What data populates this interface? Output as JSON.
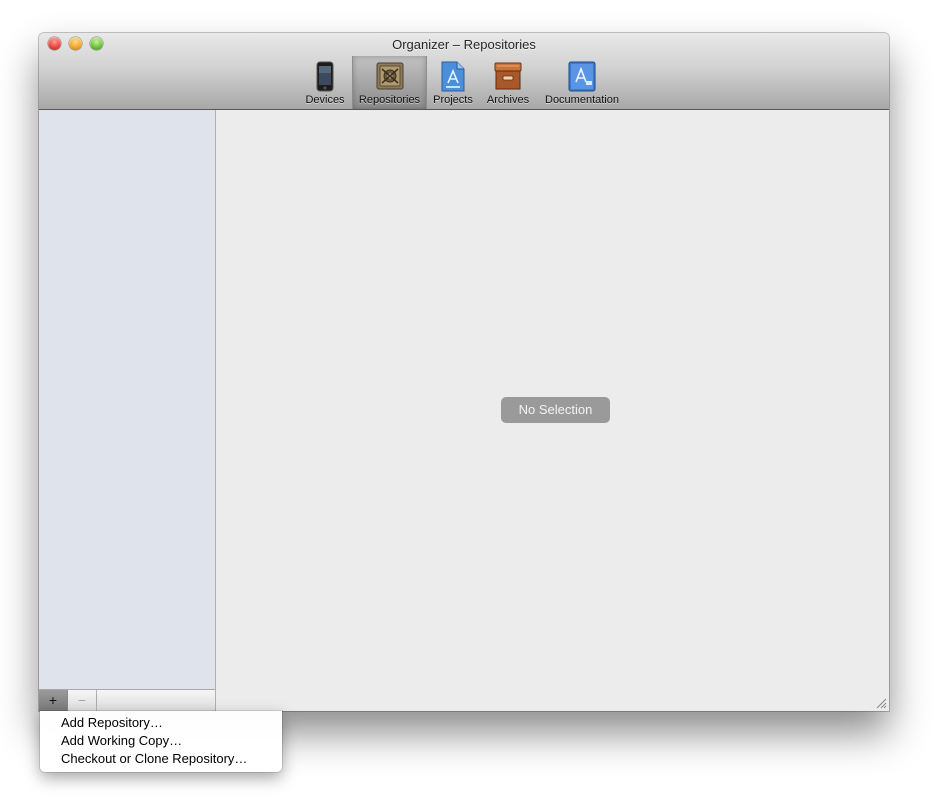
{
  "window": {
    "title": "Organizer – Repositories"
  },
  "toolbar": {
    "items": [
      {
        "label": "Devices",
        "icon": "iphone-icon",
        "selected": false
      },
      {
        "label": "Repositories",
        "icon": "repository-safe-icon",
        "selected": true
      },
      {
        "label": "Projects",
        "icon": "project-document-icon",
        "selected": false
      },
      {
        "label": "Archives",
        "icon": "archive-box-icon",
        "selected": false
      },
      {
        "label": "Documentation",
        "icon": "documentation-book-icon",
        "selected": false
      }
    ]
  },
  "sidebar": {
    "add_label": "+",
    "remove_label": "−"
  },
  "content": {
    "empty_state": "No Selection"
  },
  "add_menu": {
    "items": [
      {
        "label": "Add Repository…"
      },
      {
        "label": "Add Working Copy…"
      },
      {
        "label": "Checkout or Clone Repository…"
      }
    ]
  },
  "colors": {
    "sidebar_bg": "#dee3ec",
    "content_bg": "#ececec",
    "empty_state_bg": "#9a9a9a"
  }
}
